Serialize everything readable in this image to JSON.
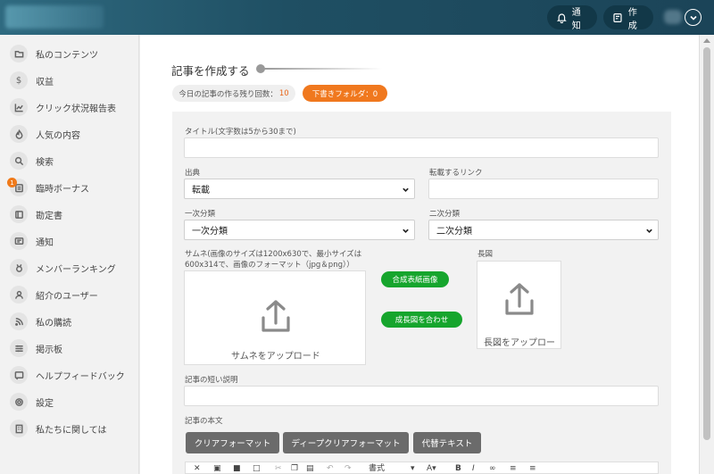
{
  "header": {
    "notify_label": "通知",
    "create_label": "作成"
  },
  "sidebar": {
    "items": [
      {
        "label": "私のコンテンツ",
        "icon": "folder-icon"
      },
      {
        "label": "収益",
        "icon": "dollar-icon"
      },
      {
        "label": "クリック状況報告表",
        "icon": "chart-line-icon"
      },
      {
        "label": "人気の内容",
        "icon": "flame-icon"
      },
      {
        "label": "検索",
        "icon": "search-icon"
      },
      {
        "label": "臨時ボーナス",
        "icon": "bonus-icon",
        "badge": "1"
      },
      {
        "label": "勘定書",
        "icon": "bill-icon"
      },
      {
        "label": "通知",
        "icon": "message-icon"
      },
      {
        "label": "メンバーランキング",
        "icon": "medal-icon"
      },
      {
        "label": "紹介のユーザー",
        "icon": "users-icon"
      },
      {
        "label": "私の購読",
        "icon": "rss-icon"
      },
      {
        "label": "掲示板",
        "icon": "sliders-icon"
      },
      {
        "label": "ヘルプフィードバック",
        "icon": "feedback-icon"
      },
      {
        "label": "設定",
        "icon": "gear-icon"
      },
      {
        "label": "私たちに関しては",
        "icon": "building-icon"
      }
    ]
  },
  "main": {
    "page_title": "記事を作成する",
    "remaining_label": "今日の記事の作る残り回数：",
    "remaining_count": "10",
    "drafts_label": "下書きフォルダ：0",
    "form": {
      "title_label": "タイトル(文字数は5から30まで)",
      "source_label": "出典",
      "source_value": "転載",
      "repost_link_label": "転載するリンク",
      "primary_category_label": "一次分類",
      "primary_category_value": "一次分類",
      "secondary_category_label": "二次分類",
      "secondary_category_value": "二次分類",
      "thumbnail_label_line1": "サムネ(画像のサイズは1200x630で、最小サイズは",
      "thumbnail_label_line2": "600x314で、画像のフォーマット（jpg＆png））",
      "thumbnail_upload_text": "サムネをアップロード",
      "compose_cover_button": "合成表紙画像",
      "compose_long_button": "成長図を合わせ",
      "long_image_label": "長図",
      "long_image_upload_text": "長図をアップロー",
      "short_desc_label": "記事の短い説明",
      "body_label": "記事の本文",
      "clear_format_button": "クリアフォーマット",
      "deep_clear_format_button": "ディープクリアフォーマット",
      "replace_text_button": "代替テキスト",
      "toolbar_format_label": "書式"
    }
  },
  "colors": {
    "header": "#1f4f63",
    "accent_orange": "#f0781e",
    "green": "#16a52d",
    "dark_button": "#6b6b6b"
  }
}
